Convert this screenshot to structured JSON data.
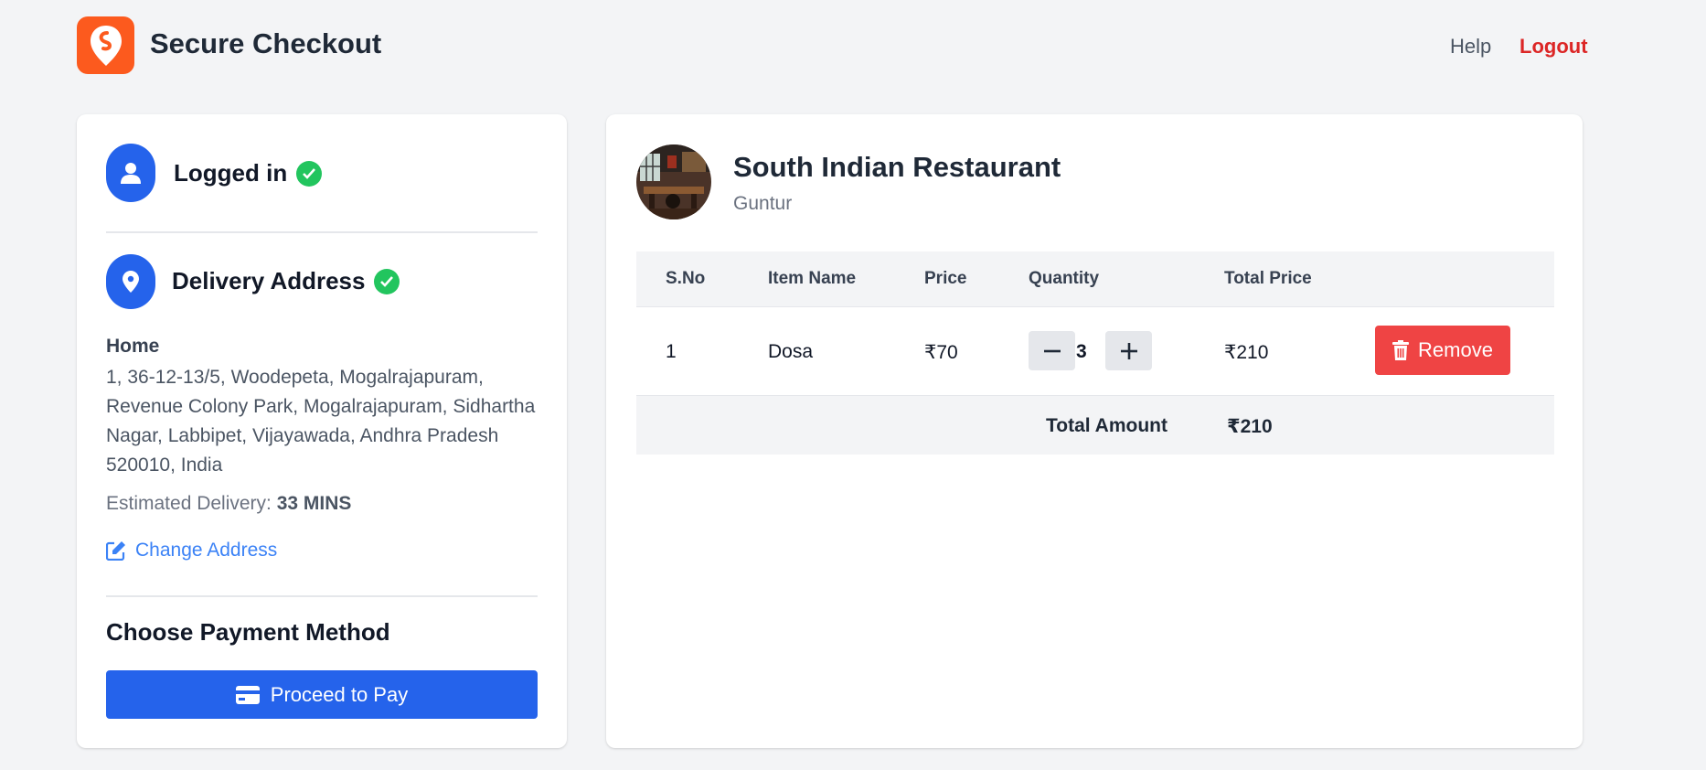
{
  "header": {
    "title": "Secure Checkout",
    "nav": {
      "help": "Help",
      "logout": "Logout"
    }
  },
  "checkout": {
    "login": {
      "title": "Logged in"
    },
    "address": {
      "title": "Delivery Address",
      "label": "Home",
      "text": "1, 36-12-13/5, Woodepeta, Mogalrajapuram, Revenue Colony Park, Mogalrajapuram, Sidhartha Nagar, Labbipet, Vijayawada, Andhra Pradesh 520010, India",
      "eta_label": "Estimated Delivery:",
      "eta_value": "33 MINS",
      "change_label": "Change Address"
    },
    "payment": {
      "title": "Choose Payment Method",
      "button_label": "Proceed to Pay"
    }
  },
  "restaurant": {
    "name": "South Indian Restaurant",
    "city": "Guntur"
  },
  "cart": {
    "columns": [
      "S.No",
      "Item Name",
      "Price",
      "Quantity",
      "Total Price"
    ],
    "items": [
      {
        "sno": "1",
        "name": "Dosa",
        "price": "₹70",
        "quantity": "3",
        "total": "₹210",
        "remove_label": "Remove"
      }
    ],
    "total_label": "Total Amount",
    "total_value": "₹210"
  },
  "colors": {
    "brand": "#fc5a1e",
    "primary": "#2563eb",
    "success": "#22c55e",
    "danger": "#ef4444",
    "logout": "#dc2626"
  },
  "icons": {
    "logo": "swiggy-logo-icon",
    "user": "user-icon",
    "location": "map-pin-icon",
    "check": "check-circle-icon",
    "edit": "edit-icon",
    "card": "credit-card-icon",
    "trash": "trash-icon",
    "minus": "minus-icon",
    "plus": "plus-icon"
  }
}
